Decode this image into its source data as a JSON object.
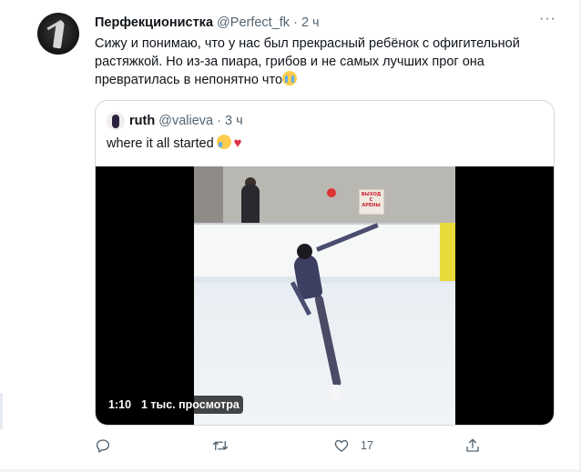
{
  "tweet": {
    "author_name": "Перфекционистка",
    "handle": "@Perfect_fk",
    "separator": "·",
    "time": "2 ч",
    "text": "Сижу и понимаю, что у нас был прекрасный ребёнок с офигительной растяжкой. Но из-за пиара, грибов и не самых лучших прог она превратилась в непонятно что",
    "text_emoji": "loudly-crying-face"
  },
  "quote": {
    "author_name": "ruth",
    "handle": "@valieva",
    "separator": "·",
    "time": "3 ч",
    "text": "where it all started",
    "emojis": [
      "face-holding-back-tears",
      "red-heart"
    ],
    "video": {
      "duration": "1:10",
      "views": "1 тыс. просмотра",
      "sign_text": "ВЫХОД С АРЕНЫ"
    }
  },
  "actions": {
    "reply_icon": "reply-icon",
    "retweet_icon": "retweet-icon",
    "like_icon": "like-icon",
    "like_count": "17",
    "share_icon": "share-icon"
  },
  "colors": {
    "text_primary": "#0f1419",
    "text_secondary": "#536471",
    "border": "#cfd9de",
    "heart": "#dd2e44"
  }
}
